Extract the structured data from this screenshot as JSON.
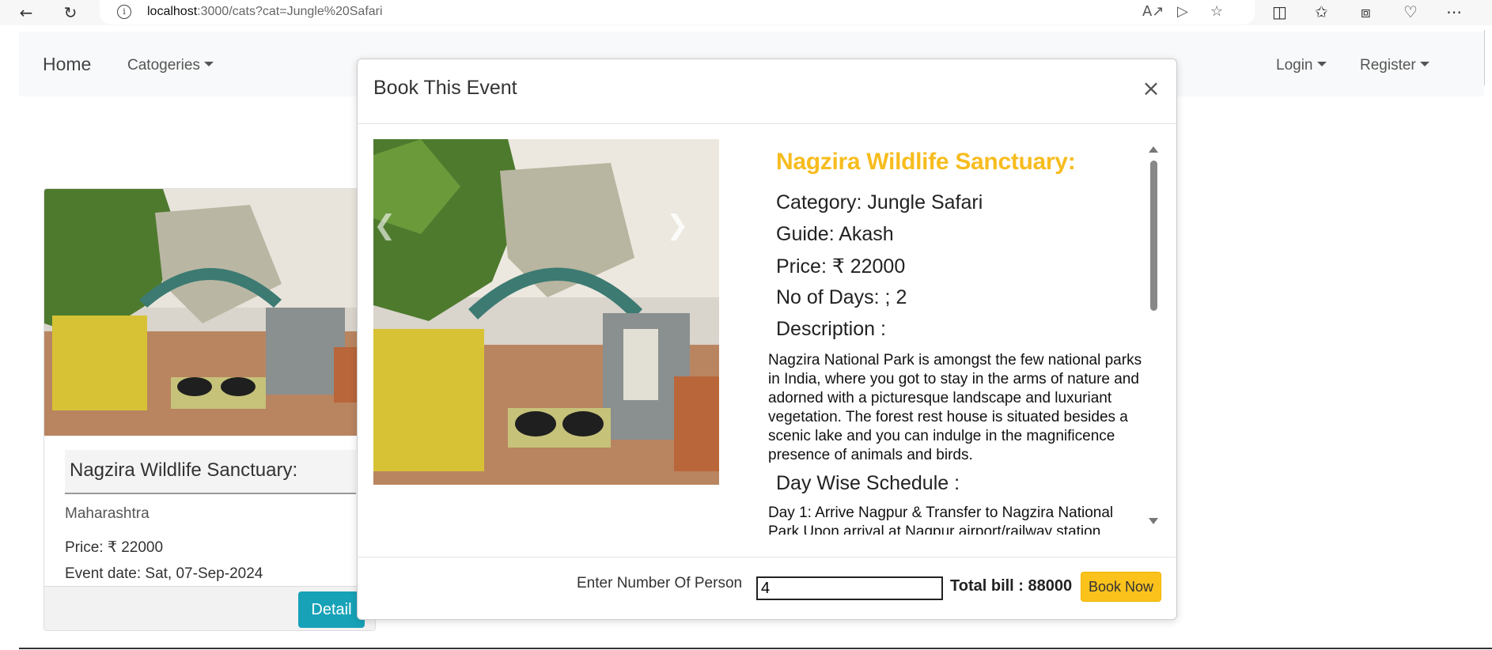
{
  "browser": {
    "url_host": "localhost",
    "url_rest": ":3000/cats?cat=Jungle%20Safari",
    "icons": [
      "back-icon",
      "reload-icon",
      "info-icon",
      "read-aloud-icon",
      "app-icon",
      "favorite-icon",
      "split-screen-icon",
      "favorites-icon",
      "collections-icon",
      "browser-essentials-icon",
      "more-icon"
    ]
  },
  "nav": {
    "home": "Home",
    "categories": "Catogeries",
    "login": "Login",
    "register": "Register"
  },
  "card": {
    "title": "Nagzira Wildlife Sanctuary:",
    "state": "Maharashtra",
    "price": "Price: ₹ 22000",
    "date": "Event date: Sat, 07-Sep-2024",
    "detail_button": "Detail"
  },
  "modal": {
    "title": "Book This Event",
    "close": "×",
    "event_title": "Nagzira Wildlife Sanctuary:",
    "category": "Category: Jungle Safari",
    "guide": "Guide: Akash",
    "price": "Price: ₹ 22000",
    "days": "No of Days: ; 2",
    "description_heading": "Description :",
    "description": "Nagzira National Park is amongst the few national parks in India, where you got to stay in the arms of nature and adorned with a picturesque landscape and luxuriant vegetation. The forest rest house is situated besides a scenic lake and you can indulge in the magnificence presence of animals and birds.",
    "schedule_heading": "Day Wise Schedule :",
    "schedule": "Day 1: Arrive Nagpur & Transfer to Nagzira National Park Upon arrival at Nagpur airport/railway station",
    "person_label": "Enter Number Of Person",
    "person_value": "4",
    "total": "Total bill : 88000",
    "book_button": "Book Now"
  },
  "colors": {
    "accent_yellow": "#fbc21c",
    "title_yellow": "#f7bc1e",
    "info_teal": "#17a2b8"
  }
}
